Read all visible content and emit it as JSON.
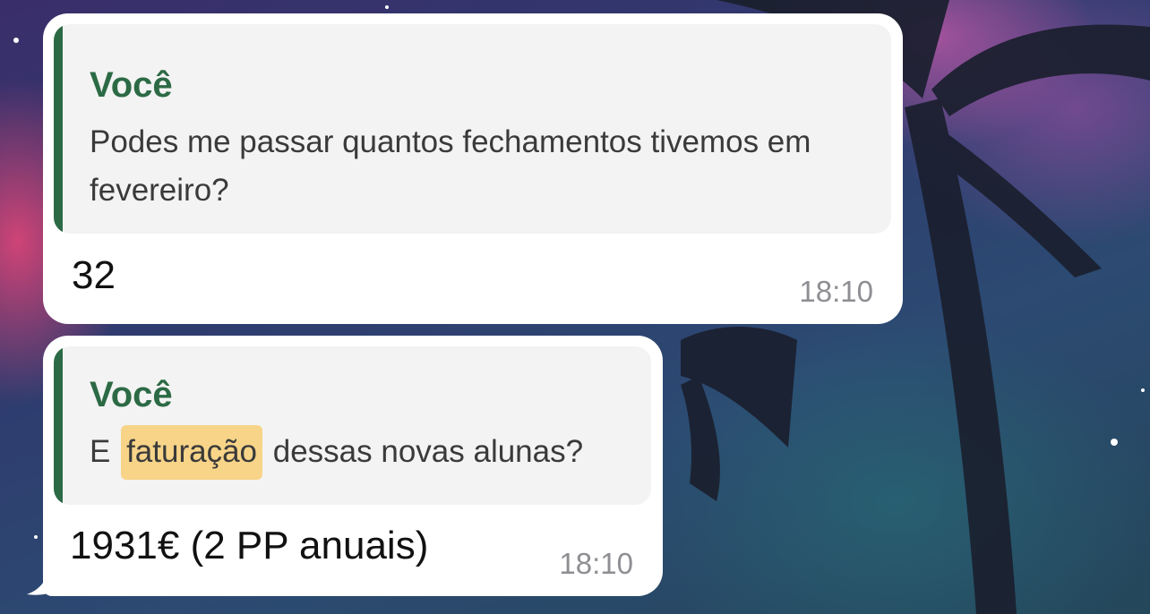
{
  "colors": {
    "quote_accent": "#2c6a45",
    "highlight": "#f7d488",
    "bubble_bg": "#ffffff",
    "quote_bg": "#f3f3f3",
    "timestamp": "#8e8e93"
  },
  "messages": [
    {
      "reply": {
        "author": "Você",
        "text": "Podes me passar quantos fechamentos tivemos em fevereiro?"
      },
      "text": "32",
      "time": "18:10"
    },
    {
      "reply": {
        "author": "Você",
        "text_before": "E ",
        "highlight": "faturação",
        "text_after": " dessas novas alunas?"
      },
      "text": "1931€ (2 PP anuais)",
      "time": "18:10"
    }
  ]
}
